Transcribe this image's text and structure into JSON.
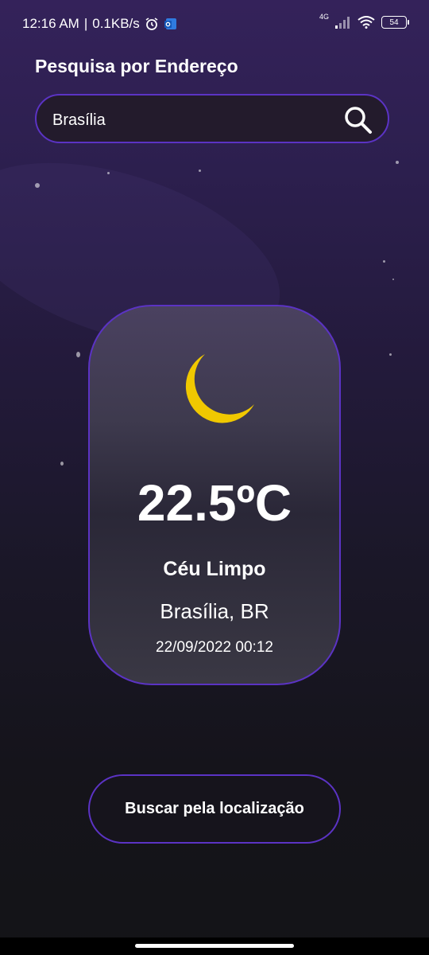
{
  "status_bar": {
    "time": "12:16 AM",
    "separator": "|",
    "speed": "0.1KB/s",
    "network": "4G",
    "battery": "54"
  },
  "search": {
    "title": "Pesquisa por Endereço",
    "value": "Brasília"
  },
  "weather": {
    "icon": "moon-icon",
    "temperature": "22.5ºC",
    "condition": "Céu Limpo",
    "location": "Brasília, BR",
    "datetime": "22/09/2022 00:12"
  },
  "location_button": {
    "label": "Buscar pela localização"
  },
  "colors": {
    "accent": "#5b33c4",
    "moon": "#f0c800",
    "background_top": "#34225a",
    "background_bottom": "#141417"
  }
}
